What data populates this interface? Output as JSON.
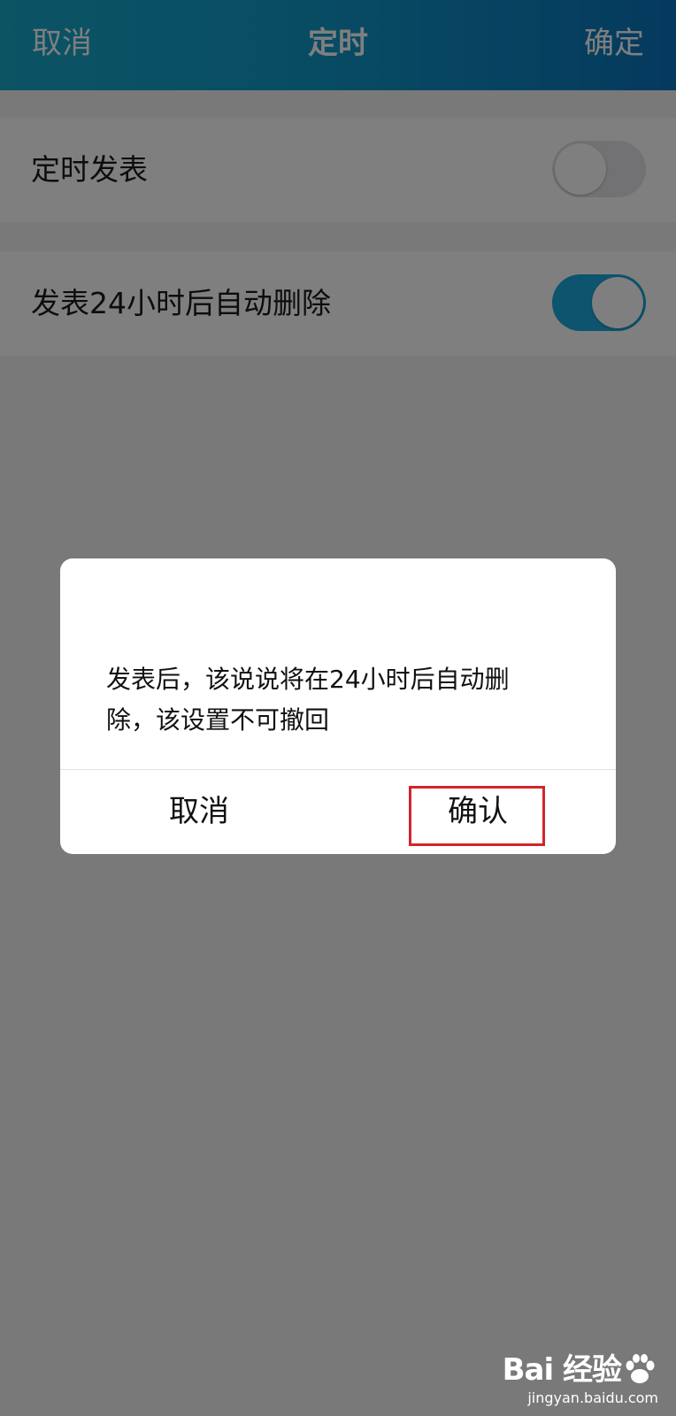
{
  "header": {
    "cancel_label": "取消",
    "title": "定时",
    "confirm_label": "确定"
  },
  "settings": {
    "items": [
      {
        "label": "定时发表",
        "enabled": false
      },
      {
        "label": "发表24小时后自动删除",
        "enabled": true
      }
    ]
  },
  "dialog": {
    "message": "发表后，该说说将在24小时后自动删除，该设置不可撤回",
    "cancel_label": "取消",
    "confirm_label": "确认"
  },
  "watermark": {
    "logo": "Bai 经验",
    "url": "jingyan.baidu.com"
  },
  "colors": {
    "header_start": "#16a8c9",
    "header_end": "#0a74bc",
    "toggle_on": "#1ba9dc",
    "highlight": "#d0262e"
  }
}
